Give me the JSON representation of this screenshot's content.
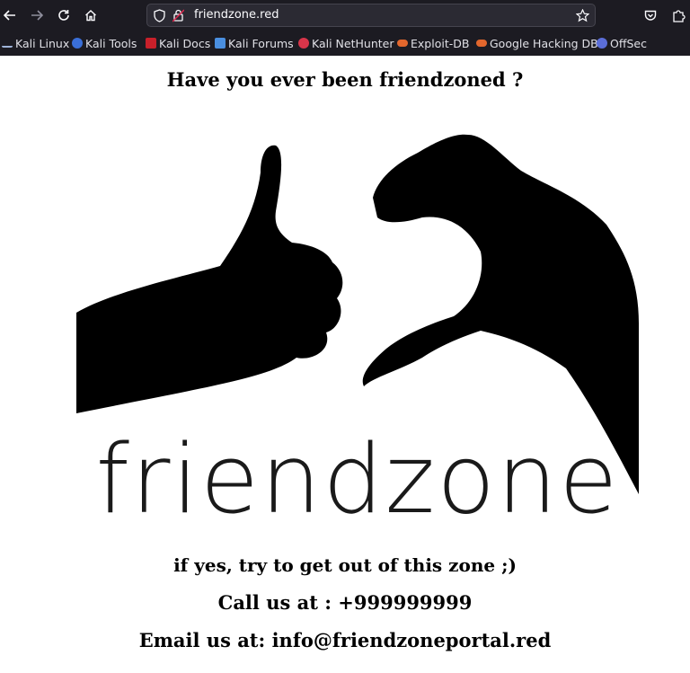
{
  "browser": {
    "url": "friendzone.red",
    "bookmarks": [
      {
        "label": "Kali Linux",
        "icon": "kali-dragon-icon"
      },
      {
        "label": "Kali Tools",
        "icon": "kali-tools-icon"
      },
      {
        "label": "Kali Docs",
        "icon": "kali-docs-icon"
      },
      {
        "label": "Kali Forums",
        "icon": "kali-forums-icon"
      },
      {
        "label": "Kali NetHunter",
        "icon": "kali-nethunter-icon"
      },
      {
        "label": "Exploit-DB",
        "icon": "exploit-db-icon"
      },
      {
        "label": "Google Hacking DB",
        "icon": "ghdb-icon"
      },
      {
        "label": "OffSec",
        "icon": "offsec-icon"
      }
    ]
  },
  "page": {
    "heading": "Have you ever been friendzoned ?",
    "image_text": "friendzone",
    "line1": "if yes, try to get out of this zone ;)",
    "line2": "Call us at : +999999999",
    "line3": "Email us at: info@friendzoneportal.red"
  },
  "colors": {
    "toolbar_bg": "#1c1b22",
    "urlbar_bg": "#2b2a33",
    "page_bg": "#ffffff",
    "text": "#000000"
  }
}
